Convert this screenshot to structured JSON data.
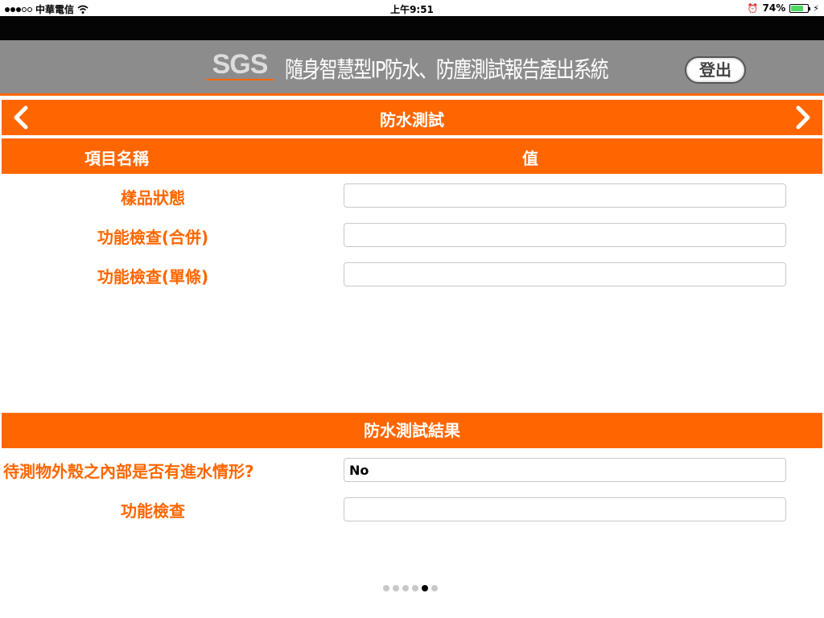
{
  "status_bar": {
    "carrier": "中華電信",
    "time": "上午9:51",
    "battery": "74%",
    "battery_level": 0.74
  },
  "header": {
    "logo": "SGS",
    "title": "隨身智慧型IP防水、防塵測試報告產出系統",
    "logout_label": "登出"
  },
  "nav": {
    "title": "防水測試",
    "prev_icon": "chevron-left-icon",
    "next_icon": "chevron-right-icon"
  },
  "columns": {
    "name": "項目名稱",
    "value": "值"
  },
  "fields": [
    {
      "label": "樣品狀態",
      "value": ""
    },
    {
      "label": "功能檢查(合併)",
      "value": ""
    },
    {
      "label": "功能檢查(單條)",
      "value": ""
    }
  ],
  "result_section": {
    "title": "防水測試結果",
    "fields": [
      {
        "label": "待測物外殼之內部是否有進水情形?",
        "value": "No"
      },
      {
        "label": "功能檢查",
        "value": ""
      }
    ]
  },
  "pagination": {
    "total": 6,
    "current": 5
  },
  "colors": {
    "accent": "#ff6600",
    "header_bg": "#8c8c8c"
  }
}
